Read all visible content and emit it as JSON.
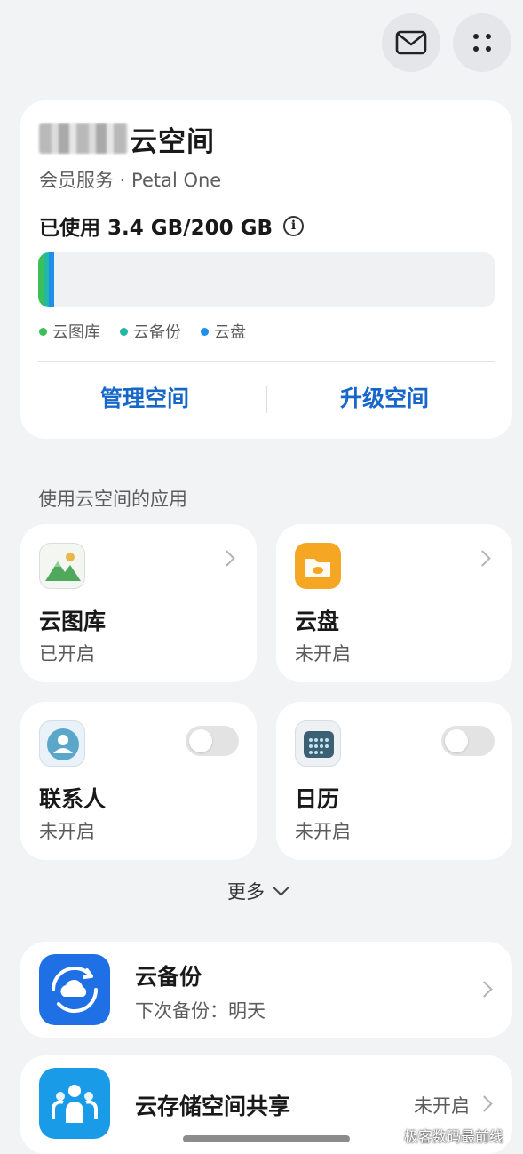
{
  "header": {
    "mail_icon": "mail-icon",
    "more_icon": "more-grid-icon"
  },
  "storage": {
    "title": "云空间",
    "subtitle": "会员服务 · Petal One",
    "usage": "已使用 3.4 GB/200 GB",
    "legend": [
      {
        "label": "云图库",
        "color": "#3bbf5a"
      },
      {
        "label": "云备份",
        "color": "#22b8a5"
      },
      {
        "label": "云盘",
        "color": "#1e90e8"
      }
    ],
    "manage_label": "管理空间",
    "upgrade_label": "升级空间"
  },
  "apps_section": {
    "title": "使用云空间的应用",
    "apps": [
      {
        "name": "云图库",
        "status": "已开启"
      },
      {
        "name": "云盘",
        "status": "未开启"
      },
      {
        "name": "联系人",
        "status": "未开启",
        "toggle_on": false
      },
      {
        "name": "日历",
        "status": "未开启",
        "toggle_on": false
      }
    ],
    "more_label": "更多"
  },
  "backup": {
    "title": "云备份",
    "subtitle": "下次备份：明天"
  },
  "sharing": {
    "title": "云存储空间共享",
    "status": "未开启"
  },
  "watermark": "极客数码最前线",
  "accent_color": "#1767c9"
}
